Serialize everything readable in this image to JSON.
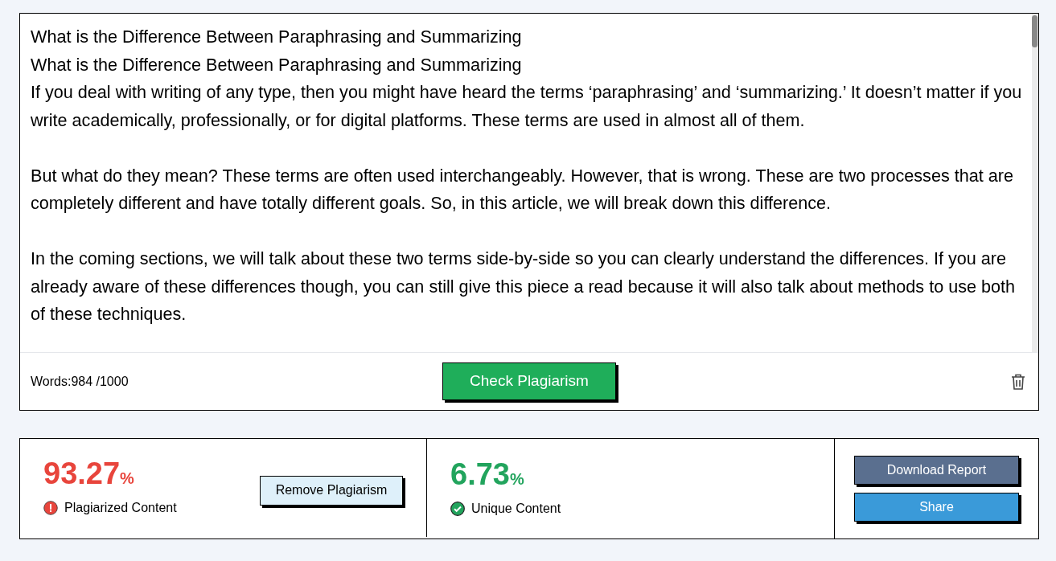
{
  "editor": {
    "paragraphs": [
      "What is the Difference Between Paraphrasing and Summarizing",
      "What is the Difference Between Paraphrasing and Summarizing",
      "If you deal with writing of any type, then you might have heard the terms ‘paraphrasing’ and ‘summarizing.’ It doesn’t matter if you write academically, professionally, or for digital platforms. These terms are used in almost all of them.",
      "But what do they mean? These terms are often used interchangeably. However, that is wrong. These are two processes that are completely different and have totally different goals. So, in this article, we will break down this difference.",
      "In the coming sections, we will talk about these two terms side-by-side so you can clearly understand the differences. If you are already aware of these differences though, you can still give this piece a read because it will also talk about methods to use both of these techniques."
    ],
    "word_count": "Words:984 /1000",
    "check_button": "Check Plagiarism"
  },
  "results": {
    "plagiarized": {
      "value": "93.27",
      "unit": "%",
      "label": "Plagiarized Content",
      "color": "#e8453c"
    },
    "remove_button": "Remove Plagiarism",
    "unique": {
      "value": "6.73",
      "unit": "%",
      "label": "Unique Content",
      "color": "#22a45d"
    },
    "buttons": [
      {
        "label": "Download Report",
        "color": "#5a6f8f"
      },
      {
        "label": "Share",
        "color": "#3a9ad9"
      }
    ]
  }
}
